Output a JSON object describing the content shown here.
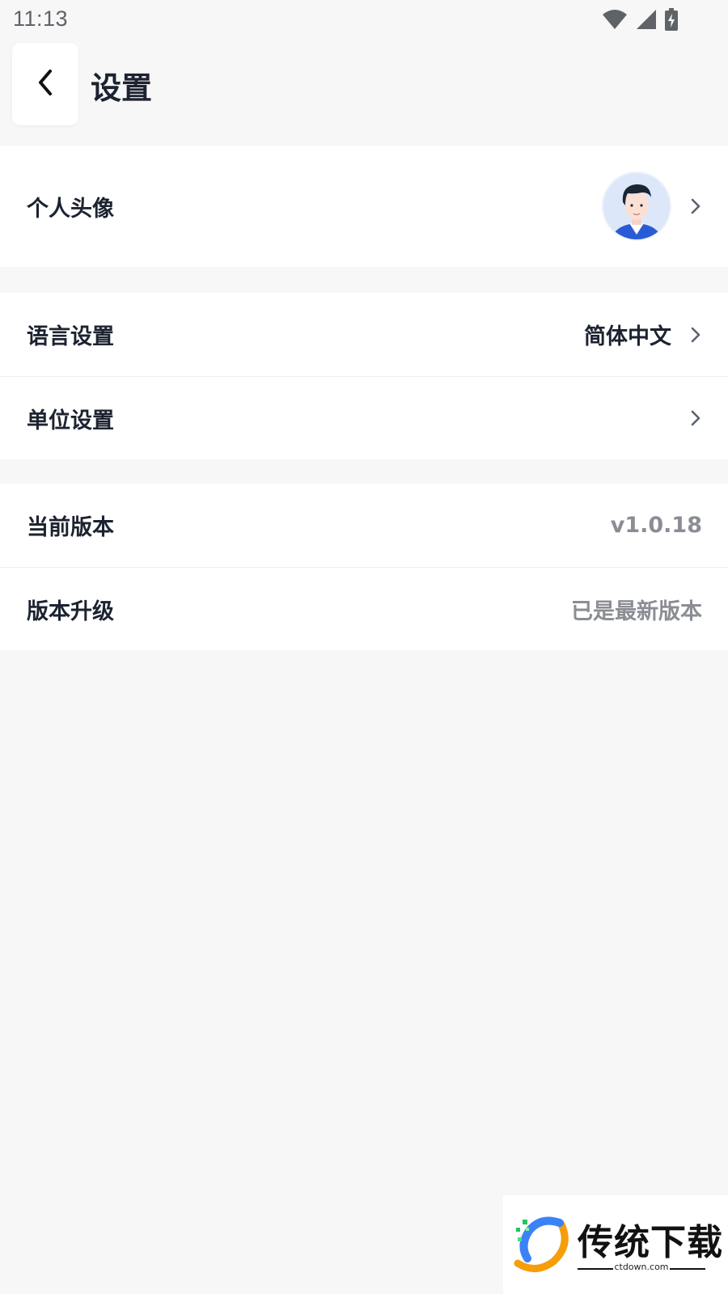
{
  "status_bar": {
    "time": "11:13",
    "icons": [
      "wifi-icon",
      "cellular-signal-icon",
      "battery-charging-icon"
    ]
  },
  "header": {
    "title": "设置",
    "back_icon": "chevron-left-icon"
  },
  "groups": [
    {
      "rows": [
        {
          "label": "个人头像",
          "value": "",
          "avatar": true,
          "chevron": true
        }
      ]
    },
    {
      "rows": [
        {
          "label": "语言设置",
          "value": "简体中文",
          "chevron": true
        },
        {
          "label": "单位设置",
          "value": "",
          "chevron": true
        }
      ]
    },
    {
      "rows": [
        {
          "label": "当前版本",
          "value": "v1.0.18",
          "chevron": false
        },
        {
          "label": "版本升级",
          "value": "已是最新版本",
          "chevron": false
        }
      ]
    }
  ],
  "watermark": {
    "brand": "传统下载",
    "domain": "ctdown.com"
  },
  "colors": {
    "page_background": "#f7f7f7",
    "card_background": "#ffffff",
    "primary_text": "#1c2330",
    "muted_text": "#8a8d93",
    "chevron": "#5a6270"
  }
}
